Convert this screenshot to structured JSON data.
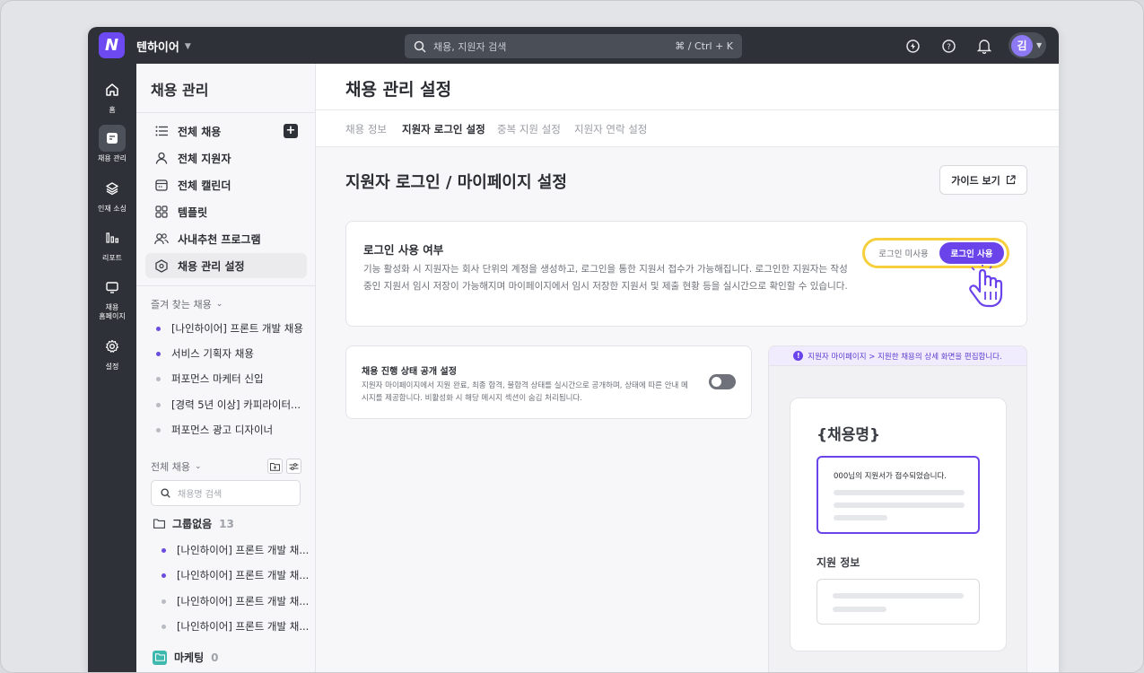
{
  "topbar": {
    "logo": "N",
    "org_name": "텐하이어",
    "search_placeholder": "채용, 지원자 검색",
    "search_shortcut": "⌘ / Ctrl + K",
    "avatar": "김"
  },
  "rail": [
    {
      "label": "홈",
      "icon": "home-icon"
    },
    {
      "label": "채용 관리",
      "icon": "document-icon"
    },
    {
      "label": "인재 소싱",
      "icon": "layers-icon"
    },
    {
      "label": "리포트",
      "icon": "bar-chart-icon"
    },
    {
      "label": "채용\n홈페이지",
      "icon": "monitor-icon"
    },
    {
      "label": "설정",
      "icon": "gear-icon"
    }
  ],
  "sidebar": {
    "title": "채용 관리",
    "nav": [
      {
        "label": "전체 채용",
        "icon": "list-icon"
      },
      {
        "label": "전체 지원자",
        "icon": "user-icon"
      },
      {
        "label": "전체 캘린더",
        "icon": "calendar-icon"
      },
      {
        "label": "템플릿",
        "icon": "grid-icon"
      },
      {
        "label": "사내추천 프로그램",
        "icon": "users-icon"
      },
      {
        "label": "채용 관리 설정",
        "icon": "hexagon-icon"
      }
    ],
    "favorites_label": "즐겨 찾는 채용",
    "favorites": [
      {
        "label": "[나인하이어] 프론트 개발 채용",
        "active": true
      },
      {
        "label": "서비스 기획자 채용",
        "active": true
      },
      {
        "label": "퍼포먼스 마케터 신입",
        "active": false
      },
      {
        "label": "[경력 5년 이상] 카피라이터...",
        "active": false
      },
      {
        "label": "퍼포먼스 광고 디자이너",
        "active": false
      }
    ],
    "all_label": "전체 채용",
    "search_placeholder": "채용명 검색",
    "group1": {
      "name": "그룹없음",
      "count": "13"
    },
    "group1_items": [
      {
        "label": "[나인하이어] 프론트 개발 채...",
        "active": true
      },
      {
        "label": "[나인하이어] 프론트 개발 채...",
        "active": true
      },
      {
        "label": "[나인하이어] 프론트 개발 채...",
        "active": false
      },
      {
        "label": "[나인하이어] 프론트 개발 채...",
        "active": false
      }
    ],
    "group2": {
      "name": "마케팅",
      "count": "0"
    }
  },
  "main": {
    "title": "채용 관리 설정",
    "tabs": [
      "채용 정보",
      "지원자 로그인 설정",
      "중복 지원 설정",
      "지원자 연락 설정"
    ],
    "active_tab": 1,
    "section_title": "지원자 로그인 / 마이페이지 설정",
    "guide_button": "가이드 보기",
    "login_card": {
      "title": "로그인 사용 여부",
      "desc": "기능 활성화 시 지원자는 회사 단위의 계정을 생성하고, 로그인을 통한 지원서 접수가 가능해집니다. 로그인한 지원자는 작성 중인 지원서 임시 저장이 가능해지며 마이페이지에서 임시 저장한 지원서 및 제출 현황 등을 실시간으로 확인할 수 있습니다.",
      "option_off": "로그인 미사용",
      "option_on": "로그인 사용",
      "selected": "로그인 사용"
    },
    "status_card": {
      "title": "채용 진행 상태 공개 설정",
      "desc": "지원자 마이페이지에서 지원 완료, 최종 합격, 불합격 상태를 실시간으로 공개하며, 상태에 따른 안내 메시지를 제공합니다. 비활성화 시 해당 메시지 섹션이 숨김 처리됩니다.",
      "enabled": false
    },
    "preview": {
      "banner": "지원자 마이페이지 > 지원한 채용의 상세 화면을 편집합니다.",
      "job_title": "{채용명}",
      "message": "000님의 지원서가 접수되었습니다.",
      "info_title": "지원 정보"
    }
  },
  "colors": {
    "accent": "#6a43ea",
    "highlight": "#f6cf3d",
    "dark": "#2e3138"
  }
}
